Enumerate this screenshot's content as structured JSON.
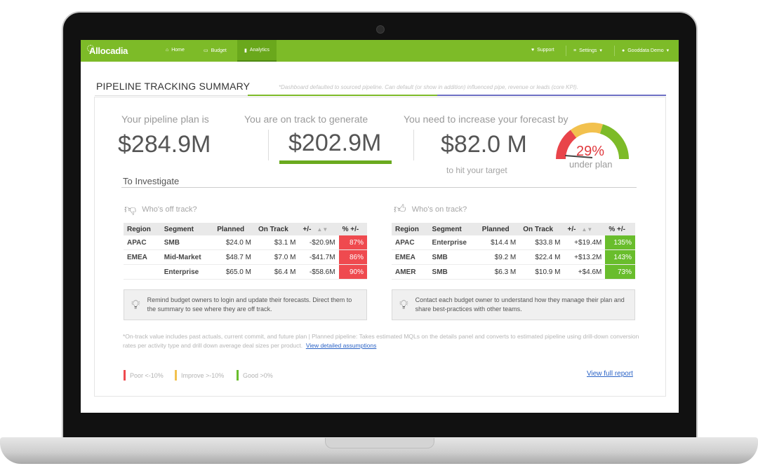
{
  "nav": {
    "logo": "Allocadia",
    "items": [
      {
        "label": "Home",
        "icon": "home-icon"
      },
      {
        "label": "Budget",
        "icon": "monitor-icon"
      },
      {
        "label": "Analytics",
        "icon": "bar-chart-icon"
      }
    ],
    "support": "Support",
    "settings": "Settings",
    "user": "Gooddata Demo"
  },
  "page": {
    "title": "PIPELINE TRACKING SUMMARY",
    "note": "*Dashboard defaulted to sourced pipeline. Can default (or show in addition) influenced pipe, revenue or leads (core KPI)."
  },
  "kpis": {
    "plan_label": "Your pipeline plan is",
    "plan_value": "$284.9M",
    "track_label": "You are on track to generate",
    "track_value": "$202.9M",
    "increase_label": "You need to increase your forecast by",
    "increase_value": "$82.0 M",
    "increase_sub": "to hit your target",
    "gauge_pct": "29%",
    "gauge_label": "under plan",
    "gauge_colors": [
      "#e9444a",
      "#f2c14e",
      "#7dbb28"
    ]
  },
  "investigate": {
    "title": "To Investigate",
    "off_track": {
      "heading": "Who's off track?",
      "columns": [
        "Region",
        "Segment",
        "Planned",
        "On Track",
        "+/-",
        "% +/-"
      ],
      "rows": [
        [
          "APAC",
          "SMB",
          "$24.0 M",
          "$3.1 M",
          "-$20.9M",
          "87%"
        ],
        [
          "EMEA",
          "Mid-Market",
          "$48.7 M",
          "$7.0 M",
          "-$41.7M",
          "86%"
        ],
        [
          "",
          "Enterprise",
          "$65.0 M",
          "$6.4 M",
          "-$58.6M",
          "90%"
        ]
      ],
      "tip": "Remind budget owners to login and update their forecasts. Direct them to the summary to see where they are off track."
    },
    "on_track": {
      "heading": "Who's on track?",
      "columns": [
        "Region",
        "Segment",
        "Planned",
        "On Track",
        "+/-",
        "% +/-"
      ],
      "rows": [
        [
          "APAC",
          "Enterprise",
          "$14.4 M",
          "$33.8 M",
          "+$19.4M",
          "135%"
        ],
        [
          "EMEA",
          "SMB",
          "$9.2 M",
          "$22.4 M",
          "+$13.2M",
          "143%"
        ],
        [
          "AMER",
          "SMB",
          "$6.3 M",
          "$10.9 M",
          "+$4.6M",
          "73%"
        ]
      ],
      "tip": "Contact each budget owner to understand how they manage their plan and share best-practices with other teams."
    }
  },
  "footer": {
    "note": "*On-track value includes past actuals, current commit, and future plan | Planned pipeline: Takes estimated MQLs on the details panel and converts to estimated pipeline using drill-down conversion rates per activity type and drill down average deal sizes per product.",
    "assumptions_link": "View detailed assumptions",
    "legend": [
      {
        "label": "Poor <-10%",
        "color": "#ef4a4f"
      },
      {
        "label": "Improve >-10%",
        "color": "#f2c14e"
      },
      {
        "label": "Good >0%",
        "color": "#69bd2c"
      }
    ],
    "full_report": "View full report"
  }
}
